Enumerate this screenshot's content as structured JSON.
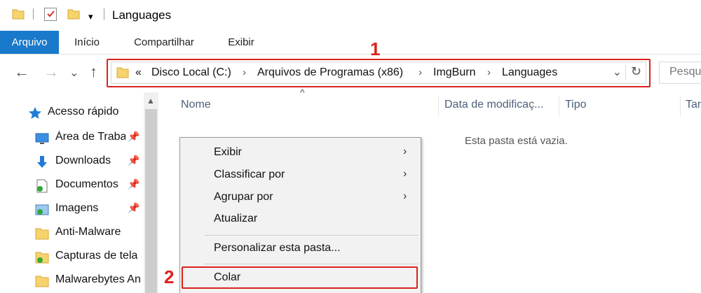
{
  "window": {
    "title": "Languages",
    "qat_dropdown": "▾"
  },
  "ribbon": {
    "tabs": [
      {
        "label": "Arquivo",
        "active": true
      },
      {
        "label": "Início",
        "active": false
      },
      {
        "label": "Compartilhar",
        "active": false
      },
      {
        "label": "Exibir",
        "active": false
      }
    ]
  },
  "nav_buttons": {
    "back": "←",
    "forward": "→",
    "recent": "⌄",
    "up": "↑"
  },
  "address_bar": {
    "overflow": "«",
    "crumbs": [
      "Disco Local (C:)",
      "Arquivos de Programas (x86)",
      "ImgBurn",
      "Languages"
    ],
    "separator": "›",
    "dropdown": "⌄",
    "refresh": "↻"
  },
  "search": {
    "placeholder": "Pesquisar"
  },
  "annotations": {
    "first": "1",
    "second": "2",
    "color": "#d9231d"
  },
  "nav_pane": {
    "items": [
      {
        "label": "Acesso rápido",
        "icon": "star-icon",
        "pinned": false
      },
      {
        "label": "Área de Traba",
        "icon": "desktop-icon",
        "pinned": true
      },
      {
        "label": "Downloads",
        "icon": "download-arrow-icon",
        "pinned": true
      },
      {
        "label": "Documentos",
        "icon": "documents-icon",
        "pinned": true
      },
      {
        "label": "Imagens",
        "icon": "pictures-icon",
        "pinned": true
      },
      {
        "label": "Anti-Malware",
        "icon": "folder-icon",
        "pinned": false
      },
      {
        "label": "Capturas de tela",
        "icon": "folder-sync-icon",
        "pinned": false
      },
      {
        "label": "Malwarebytes An",
        "icon": "folder-icon",
        "pinned": false
      }
    ],
    "pin_glyph": "📌",
    "scroll_up": "▲"
  },
  "columns": {
    "sort_caret": "^",
    "headers": [
      "Nome",
      "Data de modificaç...",
      "Tipo",
      "Tam"
    ]
  },
  "content": {
    "empty_message": "Esta pasta está vazia."
  },
  "context_menu": {
    "items": [
      {
        "label": "Exibir",
        "submenu": true
      },
      {
        "label": "Classificar por",
        "submenu": true
      },
      {
        "label": "Agrupar por",
        "submenu": true
      },
      {
        "label": "Atualizar",
        "submenu": false
      },
      {
        "label": "Personalizar esta pasta...",
        "submenu": false
      },
      {
        "label": "Colar",
        "submenu": false
      }
    ],
    "submenu_arrow": "›"
  },
  "colors": {
    "accent": "#1979ca",
    "folder": "#f6d36b",
    "highlight": "#d9231d"
  }
}
